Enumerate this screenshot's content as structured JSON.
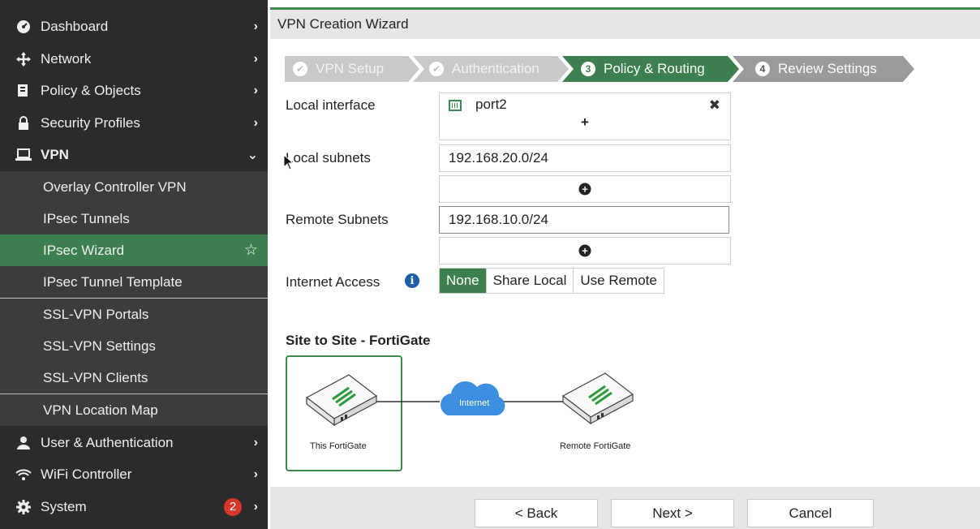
{
  "sidebar": {
    "items": [
      {
        "label": "Dashboard",
        "icon": "dashboard-icon"
      },
      {
        "label": "Network",
        "icon": "network-icon"
      },
      {
        "label": "Policy & Objects",
        "icon": "policy-icon"
      },
      {
        "label": "Security Profiles",
        "icon": "lock-icon"
      },
      {
        "label": "VPN",
        "icon": "laptop-icon"
      },
      {
        "label": "Overlay Controller VPN"
      },
      {
        "label": "IPsec Tunnels"
      },
      {
        "label": "IPsec Wizard"
      },
      {
        "label": "IPsec Tunnel Template"
      },
      {
        "label": "SSL-VPN Portals"
      },
      {
        "label": "SSL-VPN Settings"
      },
      {
        "label": "SSL-VPN Clients"
      },
      {
        "label": "VPN Location Map"
      },
      {
        "label": "User & Authentication",
        "icon": "user-icon"
      },
      {
        "label": "WiFi Controller",
        "icon": "wifi-icon"
      },
      {
        "label": "System",
        "icon": "gear-icon",
        "badge": "2"
      }
    ]
  },
  "header": {
    "title": "VPN Creation Wizard"
  },
  "steps": [
    {
      "num": "✔",
      "label": "VPN Setup",
      "state": "done"
    },
    {
      "num": "✔",
      "label": "Authentication",
      "state": "done"
    },
    {
      "num": "3",
      "label": "Policy & Routing",
      "state": "current"
    },
    {
      "num": "4",
      "label": "Review Settings",
      "state": "pending"
    }
  ],
  "form": {
    "local_interface_label": "Local interface",
    "local_interface_value": "port2",
    "local_subnets_label": "Local subnets",
    "local_subnets_value": "192.168.20.0/24",
    "remote_subnets_label": "Remote Subnets",
    "remote_subnets_value": "192.168.10.0/24",
    "internet_access_label": "Internet Access",
    "internet_access_options": [
      "None",
      "Share Local",
      "Use Remote"
    ],
    "internet_access_selected": "None"
  },
  "diagram": {
    "title": "Site to Site - FortiGate",
    "local_label": "This FortiGate",
    "remote_label": "Remote FortiGate",
    "cloud_label": "Internet"
  },
  "footer": {
    "back": "< Back",
    "next": "Next >",
    "cancel": "Cancel"
  },
  "colors": {
    "accent": "#3d7f4e",
    "sidebar_bg": "#2b2b2b",
    "step_done": "#c8c8c8",
    "step_pending": "#9a9a9a",
    "cloud": "#3b8ee0",
    "badge": "#d9362b"
  }
}
